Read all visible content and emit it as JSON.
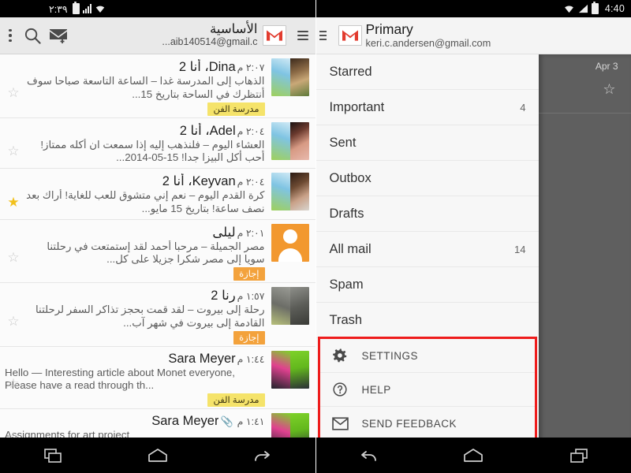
{
  "left_phone": {
    "status_bar": {
      "time": "٢:٣٩",
      "icons": [
        "battery-icon",
        "signal-icon",
        "wifi-icon"
      ]
    },
    "toolbar": {
      "hamburger": "hamburger-menu-icon",
      "logo": "gmail-logo-icon",
      "account_name": "الأساسية",
      "account_email": "aib140514@gmail.c...",
      "compose": "compose-icon",
      "search": "search-icon",
      "overflow": "overflow-menu-icon"
    },
    "emails": [
      {
        "sender": "Dina، أنا 2",
        "latin": false,
        "time": "٢:٠٧ م",
        "snippet": "الذهاب إلى المدرسة غدا – الساعة التاسعة صباحا سوف أنتظرك في الساحة بتاريخ 15...",
        "starred": false,
        "attachment": false,
        "label": "مدرسة الفن",
        "label_color": "yellow",
        "avatar": "split-photo"
      },
      {
        "sender": "Adel، أنا 2",
        "latin": false,
        "time": "٢:٠٤ م",
        "snippet": "العشاء اليوم – فلنذهب إليه إذا سمعت ان أكله ممتاز! أحب أكل البيزا جدا! 15-05-2014...",
        "starred": false,
        "attachment": false,
        "label": null,
        "label_color": null,
        "avatar": "split-photo"
      },
      {
        "sender": "Keyvan، أنا 2",
        "latin": false,
        "time": "٢:٠٤ م",
        "snippet": "كرة القدم اليوم – نعم إني متشوق للعب للغاية! أراك بعد نصف ساعة! بتاريخ 15 مايو...",
        "starred": true,
        "attachment": false,
        "label": null,
        "label_color": null,
        "avatar": "split-photo"
      },
      {
        "sender": "ليلى",
        "latin": false,
        "time": "٢:٠١ م",
        "snippet": "مصر الجميلة – مرحبا أحمد لقد إستمتعت في رحلتنا سويا إلى مصر شكرا جزيلا على كل...",
        "starred": false,
        "attachment": false,
        "label": "إجازة",
        "label_color": "orange",
        "avatar": "monogram-orange"
      },
      {
        "sender": "رنا 2",
        "latin": false,
        "time": "١:٥٧ م",
        "snippet": "رحلة إلى بيروت – لقد قمت بحجز تذاكر السفر لرحلتنا القادمة إلى بيروت في شهر آب...",
        "starred": false,
        "attachment": false,
        "label": "إجازة",
        "label_color": "orange",
        "avatar": "split-photo"
      },
      {
        "sender": "Sara Meyer",
        "latin": true,
        "time": "١:٤٤ م",
        "snippet": "Hello — Interesting article about Monet everyone, Please have a read through th...",
        "starred": false,
        "attachment": false,
        "label": "مدرسة الفن",
        "label_color": "yellow",
        "avatar": "split-photo"
      },
      {
        "sender": "Sara Meyer",
        "latin": true,
        "time": "١:٤١ م",
        "snippet": "Assignments for art project",
        "starred": false,
        "attachment": true,
        "label": null,
        "label_color": null,
        "avatar": "split-photo"
      }
    ],
    "navbar": [
      "recents-icon",
      "home-icon",
      "back-icon-rtl"
    ]
  },
  "right_phone": {
    "status_bar": {
      "time": "4:40",
      "icons": [
        "wifi-icon",
        "signal-icon",
        "battery-icon"
      ]
    },
    "header": {
      "hamburger": "hamburger-menu-icon",
      "logo": "gmail-logo-icon",
      "title": "Primary",
      "email": "keri.c.andersen@gmail.com"
    },
    "nav_items": [
      {
        "label": "Starred",
        "count": ""
      },
      {
        "label": "Important",
        "count": "4"
      },
      {
        "label": "Sent",
        "count": ""
      },
      {
        "label": "Outbox",
        "count": ""
      },
      {
        "label": "Drafts",
        "count": ""
      },
      {
        "label": "All mail",
        "count": "14"
      },
      {
        "label": "Spam",
        "count": ""
      },
      {
        "label": "Trash",
        "count": ""
      }
    ],
    "scrim": {
      "date": "Apr 3",
      "star": "star-outline-icon"
    },
    "footer_items": [
      {
        "label": "SETTINGS",
        "icon": "gear-icon"
      },
      {
        "label": "HELP",
        "icon": "help-circle-icon"
      },
      {
        "label": "SEND FEEDBACK",
        "icon": "envelope-icon"
      }
    ],
    "highlight_color": "#ee1c1c",
    "navbar": [
      "back-icon",
      "home-icon",
      "recents-icon"
    ]
  }
}
